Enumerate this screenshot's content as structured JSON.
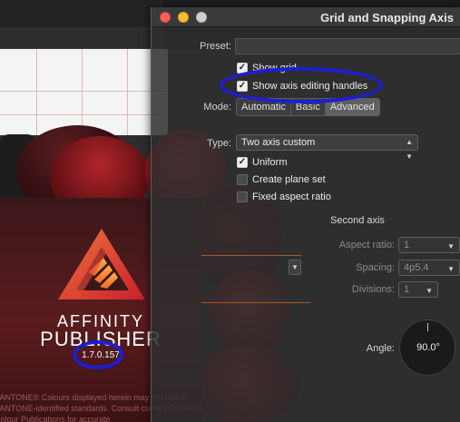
{
  "dialog": {
    "title": "Grid and Snapping Axis",
    "preset_label": "Preset:",
    "preset_value": "",
    "show_grid_label": "Show grid",
    "show_axis_handles_label": "Show axis editing handles",
    "mode_label": "Mode:",
    "mode_options": [
      "Automatic",
      "Basic",
      "Advanced"
    ],
    "mode_selected": "Advanced",
    "type_label": "Type:",
    "type_value": "Two axis custom",
    "uniform_label": "Uniform",
    "create_plane_label": "Create plane set",
    "fixed_aspect_label": "Fixed aspect ratio",
    "second_axis": {
      "title": "Second axis",
      "aspect_label": "Aspect ratio:",
      "aspect_value": "1",
      "spacing_label": "Spacing:",
      "spacing_value": "4p5.4",
      "divisions_label": "Divisions:",
      "divisions_value": "1",
      "angle_label": "Angle:",
      "angle_value": "90.0°"
    }
  },
  "splash": {
    "brand_line1": "AFFINITY",
    "brand_line2": "PUBLISHER",
    "version": "1.7.0.157",
    "legal": "PANTONE® Colours displayed herein may not match PANTONE-identified standards. Consult current PANTONE Colour Publications for accurate"
  },
  "colors": {
    "annotation": "#1d1dd6",
    "close": "#ff5f57",
    "minimize": "#febc2e",
    "maximize": "#d0d0d0",
    "brand_red": "#c92f2c"
  }
}
